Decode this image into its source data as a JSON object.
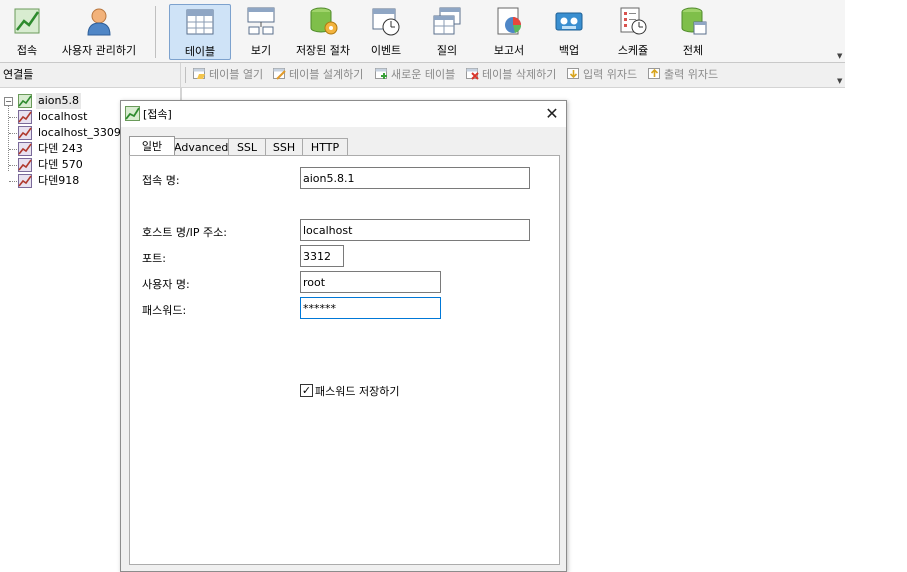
{
  "toolbar": {
    "buttons": [
      {
        "label": "접속",
        "icon": "connection-icon"
      },
      {
        "label": "사용자 관리하기",
        "icon": "user-icon"
      },
      {
        "label": "테이블",
        "icon": "table-icon",
        "active": true
      },
      {
        "label": "보기",
        "icon": "view-icon"
      },
      {
        "label": "저장된 절차",
        "icon": "procedure-icon"
      },
      {
        "label": "이벤트",
        "icon": "event-icon"
      },
      {
        "label": "질의",
        "icon": "query-icon"
      },
      {
        "label": "보고서",
        "icon": "report-icon"
      },
      {
        "label": "백업",
        "icon": "backup-icon"
      },
      {
        "label": "스케쥴",
        "icon": "schedule-icon"
      },
      {
        "label": "전체",
        "icon": "all-icon"
      }
    ]
  },
  "connections": {
    "header": "연결들",
    "items": [
      {
        "label": "aion5.8",
        "expanded": true
      },
      {
        "label": "localhost"
      },
      {
        "label": "localhost_3309"
      },
      {
        "label": "다덴 243"
      },
      {
        "label": "다덴 570"
      },
      {
        "label": "다덴918"
      }
    ]
  },
  "object_toolbar": {
    "buttons": [
      {
        "label": "테이블 열기"
      },
      {
        "label": "테이블 설계하기"
      },
      {
        "label": "새로운 테이블"
      },
      {
        "label": "테이블 삭제하기"
      },
      {
        "label": "입력 위자드"
      },
      {
        "label": "출력 위자드"
      }
    ]
  },
  "dialog": {
    "title": "[접속]",
    "tabs": [
      "일반",
      "Advanced",
      "SSL",
      "SSH",
      "HTTP"
    ],
    "active_tab": "일반",
    "fields": {
      "connection_name": {
        "label": "접속 명:",
        "value": "aion5.8.1"
      },
      "host": {
        "label": "호스트 명/IP 주소:",
        "value": "localhost"
      },
      "port": {
        "label": "포트:",
        "value": "3312"
      },
      "user": {
        "label": "사용자 명:",
        "value": "root"
      },
      "password": {
        "label": "패스워드:",
        "value": "******"
      }
    },
    "save_password": {
      "label": "패스워드 저장하기",
      "checked": true
    }
  },
  "colors": {
    "accent": "#0078d7",
    "active_tab_bg": "#cfe3f7",
    "toolbar_bg": "#f5f5f5"
  }
}
